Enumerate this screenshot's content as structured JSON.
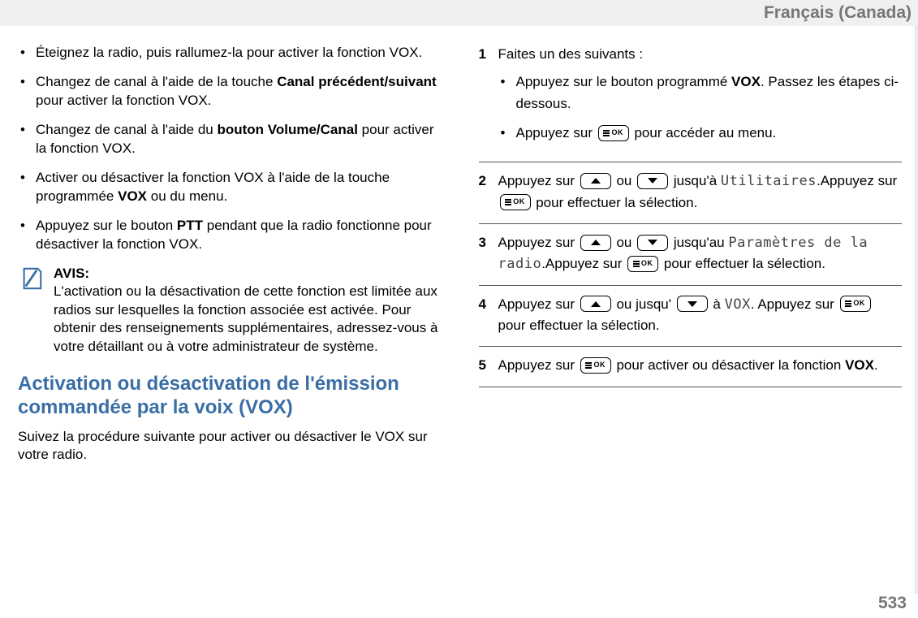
{
  "header": {
    "language": "Français (Canada)"
  },
  "page_number": "533",
  "left": {
    "bullets": [
      {
        "pre": "Éteignez la radio, puis rallumez-la pour activer la fonction VOX."
      },
      {
        "pre": "Changez de canal à l'aide de la touche ",
        "bold": "Canal précédent/suivant",
        "post": " pour activer la fonction VOX."
      },
      {
        "pre": "Changez de canal à l'aide du ",
        "bold": "bouton Volume/Canal",
        "post": " pour activer la fonction VOX."
      },
      {
        "pre": "Activer ou désactiver la fonction VOX à l'aide de la touche programmée ",
        "bold": "VOX",
        "post": " ou du menu."
      },
      {
        "pre": "Appuyez sur le bouton ",
        "bold": "PTT",
        "post": " pendant que la radio fonctionne pour désactiver la fonction VOX."
      }
    ],
    "notice": {
      "title": "AVIS:",
      "body": "L'activation ou la désactivation de cette fonction est limitée aux radios sur lesquelles la fonction associée est activée. Pour obtenir des renseignements supplémentaires, adressez-vous à votre détaillant ou à votre administrateur de système."
    },
    "heading": "Activation ou désactivation de l'émission commandée par la voix (VOX)",
    "intro": "Suivez la procédure suivante pour activer ou désactiver le VOX sur votre radio."
  },
  "right": {
    "step1": {
      "lead": "Faites un des suivants :",
      "b1_pre": "Appuyez sur le bouton programmé ",
      "b1_bold": "VOX",
      "b1_post": ". Passez les étapes ci-dessous.",
      "b2_pre": "Appuyez sur ",
      "b2_post": " pour accéder au menu."
    },
    "step2": {
      "a": "Appuyez sur ",
      "b": " ou ",
      "c": " jusqu'à ",
      "lcd": "Utilitaires",
      "d": ".Appuyez sur ",
      "e": " pour effectuer la sélection."
    },
    "step3": {
      "a": "Appuyez sur ",
      "b": " ou ",
      "c": " jusqu'au ",
      "lcd": "Paramètres de la radio",
      "d": ".Appuyez sur ",
      "e": " pour effectuer la sélection."
    },
    "step4": {
      "a": "Appuyez sur ",
      "b": " ou jusqu' ",
      "c": " à ",
      "lcd": "VOX",
      "d": ". Appuyez sur ",
      "e": " pour effectuer la sélection."
    },
    "step5": {
      "a": "Appuyez sur ",
      "b": " pour activer ou désactiver la fonction ",
      "bold": "VOX",
      "c": "."
    }
  }
}
